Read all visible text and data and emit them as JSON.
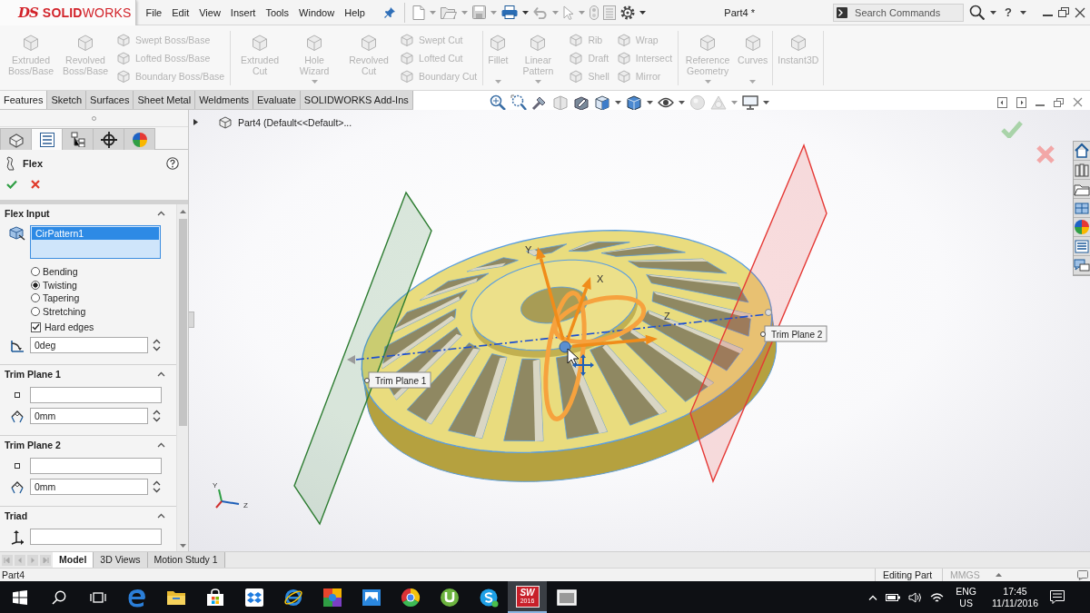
{
  "title_bar": {
    "logo": {
      "mark": "DS",
      "name": "**SOLID**WORKS"
    },
    "menu": [
      "File",
      "Edit",
      "View",
      "Insert",
      "Tools",
      "Window",
      "Help"
    ],
    "document_title": "Part4 *",
    "search": {
      "placeholder": "Search Commands"
    },
    "help": "?"
  },
  "command_manager": {
    "groups": [
      {
        "items": [
          {
            "kind": "large",
            "label": "Extruded Boss/Base",
            "disabled": true,
            "dropdown": false
          },
          {
            "kind": "large",
            "label": "Revolved Boss/Base",
            "disabled": true,
            "dropdown": false
          },
          {
            "kind": "small",
            "label": "Swept Boss/Base",
            "disabled": true
          },
          {
            "kind": "small",
            "label": "Lofted Boss/Base",
            "disabled": true
          },
          {
            "kind": "small",
            "label": "Boundary Boss/Base",
            "disabled": true
          }
        ]
      },
      {
        "items": [
          {
            "kind": "large",
            "label": "Extruded Cut",
            "disabled": true,
            "dropdown": false
          },
          {
            "kind": "large",
            "label": "Hole Wizard",
            "disabled": true,
            "dropdown": true
          },
          {
            "kind": "large",
            "label": "Revolved Cut",
            "disabled": true,
            "dropdown": false
          },
          {
            "kind": "small",
            "label": "Swept Cut",
            "disabled": true
          },
          {
            "kind": "small",
            "label": "Lofted Cut",
            "disabled": true
          },
          {
            "kind": "small",
            "label": "Boundary Cut",
            "disabled": true
          }
        ]
      },
      {
        "items": [
          {
            "kind": "large",
            "label": "Fillet",
            "disabled": true,
            "dropdown": true
          },
          {
            "kind": "large",
            "label": "Linear Pattern",
            "disabled": true,
            "dropdown": true
          },
          {
            "kind": "small",
            "label": "Rib",
            "disabled": true
          },
          {
            "kind": "small",
            "label": "Draft",
            "disabled": true
          },
          {
            "kind": "small",
            "label": "Shell",
            "disabled": true
          },
          {
            "kind": "small",
            "label": "Wrap",
            "disabled": true
          },
          {
            "kind": "small",
            "label": "Intersect",
            "disabled": true
          },
          {
            "kind": "small",
            "label": "Mirror",
            "disabled": true
          }
        ]
      },
      {
        "items": [
          {
            "kind": "large",
            "label": "Reference Geometry",
            "disabled": true,
            "dropdown": true
          },
          {
            "kind": "large",
            "label": "Curves",
            "disabled": true,
            "dropdown": true
          }
        ]
      },
      {
        "items": [
          {
            "kind": "large",
            "label": "Instant3D",
            "disabled": true,
            "dropdown": false
          }
        ]
      }
    ],
    "tabs": [
      {
        "label": "Features",
        "selected": true
      },
      {
        "label": "Sketch",
        "selected": false
      },
      {
        "label": "Surfaces",
        "selected": false
      },
      {
        "label": "Sheet Metal",
        "selected": false
      },
      {
        "label": "Weldments",
        "selected": false
      },
      {
        "label": "Evaluate",
        "selected": false
      },
      {
        "label": "SOLIDWORKS Add-Ins",
        "selected": false
      }
    ]
  },
  "feature_tree": {
    "expanded": false,
    "text": "Part4 (Default<<Default>..."
  },
  "property_manager": {
    "panel_tabs": [
      {
        "kind": "feature_tree",
        "selected": false
      },
      {
        "kind": "property_manager",
        "selected": true
      },
      {
        "kind": "configuration",
        "selected": false
      },
      {
        "kind": "dimxpert",
        "selected": false
      },
      {
        "kind": "display",
        "selected": false
      }
    ],
    "title": "Flex",
    "sections": [
      {
        "title": "Flex Input",
        "expanded": true,
        "rows": [
          {
            "kind": "selection_list",
            "items": [
              {
                "label": "CirPattern1",
                "selected": true
              }
            ]
          },
          {
            "kind": "radio_group",
            "options": [
              {
                "label": "Bending",
                "selected": false
              },
              {
                "label": "Twisting",
                "selected": true
              },
              {
                "label": "Tapering",
                "selected": false
              },
              {
                "label": "Stretching",
                "selected": false
              }
            ]
          },
          {
            "kind": "checkbox",
            "label": "Hard edges",
            "checked": true
          },
          {
            "kind": "angle_field",
            "value": "0deg"
          }
        ]
      },
      {
        "title": "Trim Plane 1",
        "expanded": true,
        "rows": [
          {
            "kind": "plane_field"
          },
          {
            "kind": "distance_field",
            "value": "0mm"
          }
        ]
      },
      {
        "title": "Trim Plane 2",
        "expanded": true,
        "rows": [
          {
            "kind": "plane_field"
          },
          {
            "kind": "distance_field",
            "value": "0mm"
          }
        ]
      },
      {
        "title": "Triad",
        "expanded": true,
        "rows": [
          {
            "kind": "triad_field"
          }
        ]
      }
    ]
  },
  "viewport": {
    "trim_planes": [
      {
        "label": "Trim Plane 1",
        "color": "#2e7d32"
      },
      {
        "label": "Trim Plane 2",
        "color": "#e53935"
      }
    ],
    "triad_axes": [
      {
        "label": "Y"
      },
      {
        "label": "X"
      },
      {
        "label": "Z"
      }
    ],
    "view_triad_axes": [
      {
        "label": "Y"
      },
      {
        "label": "Z"
      }
    ]
  },
  "bottom_tabs": [
    {
      "label": "Model",
      "selected": true
    },
    {
      "label": "3D Views",
      "selected": false
    },
    {
      "label": "Motion Study 1",
      "selected": false
    }
  ],
  "status_bar": {
    "document": "Part4",
    "mode": "Editing Part",
    "units": "MMGS"
  },
  "taskbar": {
    "apps": [
      {
        "kind": "edge",
        "active": false
      },
      {
        "kind": "explorer",
        "active": false
      },
      {
        "kind": "store",
        "active": false
      },
      {
        "kind": "dropbox",
        "active": false
      },
      {
        "kind": "ie",
        "active": false
      },
      {
        "kind": "paint",
        "active": false
      },
      {
        "kind": "picture",
        "active": false
      },
      {
        "kind": "chrome",
        "active": false
      },
      {
        "kind": "torrent",
        "active": false
      },
      {
        "kind": "skype",
        "active": false
      },
      {
        "kind": "solidworks",
        "active": true,
        "badge": [
          "SW",
          "2016"
        ]
      },
      {
        "kind": "viewer",
        "active": false
      }
    ],
    "language": [
      "ENG",
      "US"
    ],
    "clock": {
      "time": "17:45",
      "date": "11/11/2016"
    }
  }
}
